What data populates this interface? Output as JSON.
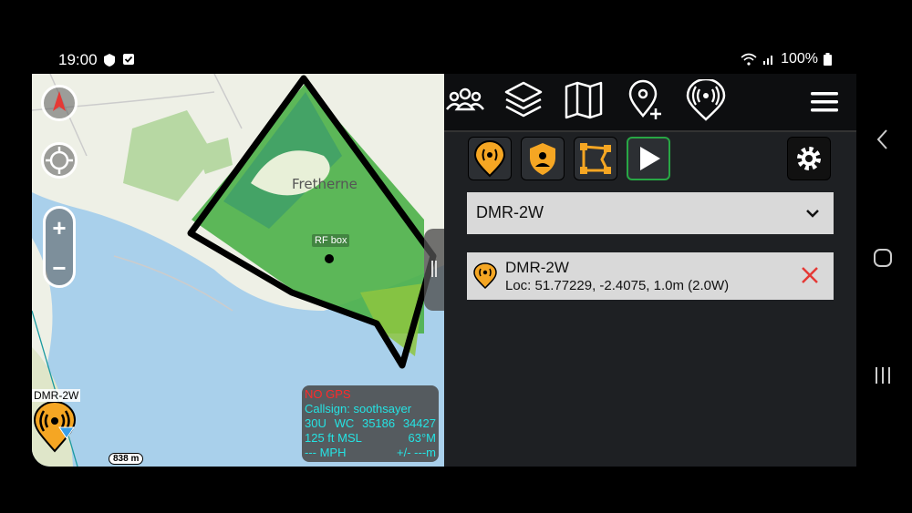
{
  "status_bar": {
    "time": "19:00",
    "battery": "100%",
    "icons": [
      "shield-notification-icon",
      "checkbox-notification-icon",
      "wifi-icon",
      "signal-icon",
      "battery-icon"
    ]
  },
  "map": {
    "place_label": "Fretherne",
    "shape_label": "RF box",
    "marker_label": "DMR-2W",
    "scale_label": "838 m",
    "zoom_in": "+",
    "zoom_out": "−",
    "gps": {
      "warning": "NO GPS",
      "callsign": "Callsign: soothsayer",
      "grid_zone": "30U",
      "grid_square": "WC",
      "easting": "35186",
      "northing": "34427",
      "altitude": "125 ft MSL",
      "heading": "63°M",
      "speed": "--- MPH",
      "accuracy": "+/- ---m"
    }
  },
  "toolbar": {
    "icons": [
      "contacts-icon",
      "layers-icon",
      "map-icon",
      "add-marker-icon",
      "radio-tower-icon",
      "hamburger-menu-icon"
    ]
  },
  "subtoolbar": {
    "icons": [
      "rf-marker-icon",
      "security-icon",
      "polygon-icon",
      "play-icon",
      "settings-icon"
    ]
  },
  "radio_select": {
    "selected": "DMR-2W"
  },
  "transmitters": [
    {
      "name": "DMR-2W",
      "loc": "Loc: 51.77229, -2.4075, 1.0m (2.0W)"
    }
  ],
  "colors": {
    "accent_orange": "#f5a623",
    "active_green": "#28a745",
    "delete_red": "#e53935",
    "gps_text": "#25e3e3"
  }
}
